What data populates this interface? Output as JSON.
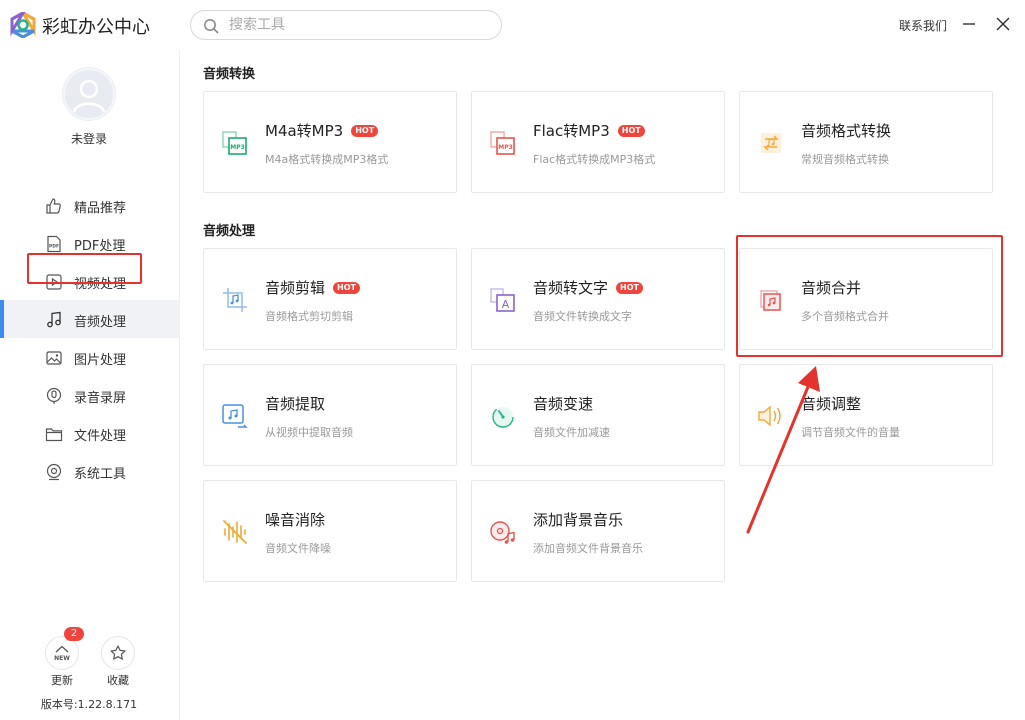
{
  "app": {
    "name": "彩虹办公中心"
  },
  "header": {
    "search_placeholder": "搜索工具",
    "contact_label": "联系我们",
    "minimize_icon": "minimize-icon",
    "close_icon": "close-icon"
  },
  "sidebar": {
    "login_status": "未登录",
    "items": [
      {
        "label": "精品推荐",
        "icon": "thumbs-up-icon"
      },
      {
        "label": "PDF处理",
        "icon": "pdf-icon"
      },
      {
        "label": "视频处理",
        "icon": "video-icon"
      },
      {
        "label": "音频处理",
        "icon": "music-note-icon",
        "active": true
      },
      {
        "label": "图片处理",
        "icon": "image-icon"
      },
      {
        "label": "录音录屏",
        "icon": "microphone-icon"
      },
      {
        "label": "文件处理",
        "icon": "folder-icon"
      },
      {
        "label": "系统工具",
        "icon": "system-tools-icon"
      }
    ],
    "update_label": "更新",
    "update_badge": "2",
    "update_icon_text": "NEW",
    "favorite_label": "收藏",
    "version": "版本号:1.22.8.171"
  },
  "sections": [
    {
      "title": "音频转换",
      "cards": [
        {
          "title": "M4a转MP3",
          "hot": "HOT",
          "desc": "M4a格式转换成MP3格式",
          "icon": "m4a-to-mp3-icon",
          "color": "#1aab6e",
          "icon_text": "MP3"
        },
        {
          "title": "Flac转MP3",
          "hot": "HOT",
          "desc": "Flac格式转换成MP3格式",
          "icon": "flac-to-mp3-icon",
          "color": "#e8544e",
          "icon_text": "MP3"
        },
        {
          "title": "音频格式转换",
          "desc": "常规音频格式转换",
          "icon": "audio-convert-icon",
          "color": "#f2a93b"
        }
      ]
    },
    {
      "title": "音频处理",
      "cards": [
        {
          "title": "音频剪辑",
          "hot": "HOT",
          "desc": "音频格式剪切剪辑",
          "icon": "audio-cut-icon",
          "color": "#4a90e2"
        },
        {
          "title": "音频转文字",
          "hot": "HOT",
          "desc": "音频文件转换成文字",
          "icon": "audio-to-text-icon",
          "color": "#8a63d2",
          "icon_text": "A"
        },
        {
          "title": "音频合并",
          "desc": "多个音频格式合并",
          "icon": "audio-merge-icon",
          "color": "#e8544e"
        },
        {
          "title": "音频提取",
          "desc": "从视频中提取音频",
          "icon": "audio-extract-icon",
          "color": "#4a90e2"
        },
        {
          "title": "音频变速",
          "desc": "音频文件加减速",
          "icon": "audio-speed-icon",
          "color": "#26b28a"
        },
        {
          "title": "音频调整",
          "desc": "调节音频文件的音量",
          "icon": "volume-icon",
          "color": "#f2a93b"
        },
        {
          "title": "噪音消除",
          "desc": "音频文件降噪",
          "icon": "noise-reduction-icon",
          "color": "#f2a93b"
        },
        {
          "title": "添加背景音乐",
          "desc": "添加音频文件背景音乐",
          "icon": "background-music-icon",
          "color": "#e8544e"
        }
      ]
    }
  ]
}
